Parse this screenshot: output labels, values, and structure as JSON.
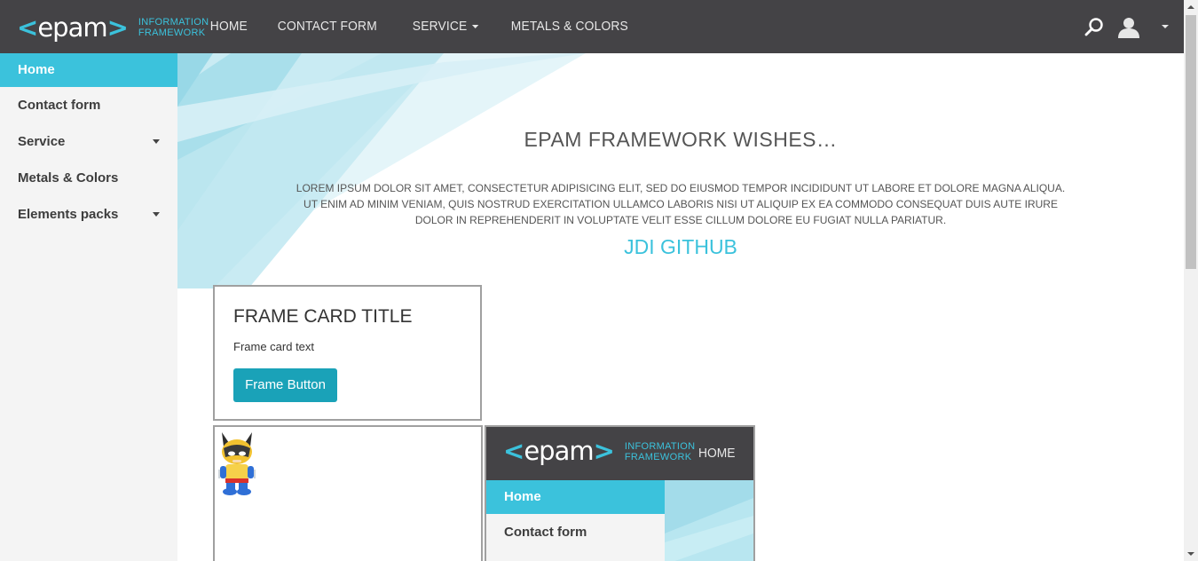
{
  "brand": {
    "logo_text": "epam",
    "logo_subtitle_line1": "INFORMATION",
    "logo_subtitle_line2": "FRAMEWORK"
  },
  "topnav": {
    "items": [
      {
        "label": "HOME"
      },
      {
        "label": "CONTACT FORM"
      },
      {
        "label": "SERVICE"
      },
      {
        "label": "METALS & COLORS"
      }
    ]
  },
  "sidebar": {
    "items": [
      {
        "label": "Home",
        "active": true
      },
      {
        "label": "Contact form"
      },
      {
        "label": "Service",
        "has_submenu": true
      },
      {
        "label": "Metals & Colors"
      },
      {
        "label": "Elements packs",
        "has_submenu": true
      }
    ]
  },
  "main": {
    "title": "EPAM FRAMEWORK WISHES…",
    "text": "LOREM IPSUM DOLOR SIT AMET, CONSECTETUR ADIPISICING ELIT, SED DO EIUSMOD TEMPOR INCIDIDUNT UT LABORE ET DOLORE MAGNA ALIQUA. UT ENIM AD MINIM VENIAM, QUIS NOSTRUD EXERCITATION ULLAMCO LABORIS NISI UT ALIQUIP EX EA COMMODO CONSEQUAT DUIS AUTE IRURE DOLOR IN REPREHENDERIT IN VOLUPTATE VELIT ESSE CILLUM DOLORE EU FUGIAT NULLA PARIATUR.",
    "github_link": "JDI GITHUB"
  },
  "frame_card": {
    "title": "FRAME CARD TITLE",
    "text": "Frame card text",
    "button_label": "Frame Button"
  },
  "mini_site": {
    "logo_text": "epam",
    "logo_subtitle_line1": "INFORMATION",
    "logo_subtitle_line2": "FRAMEWORK",
    "nav_home": "HOME",
    "sidebar_items": [
      {
        "label": "Home"
      },
      {
        "label": "Contact form"
      }
    ]
  },
  "colors": {
    "header_bg": "#444346",
    "accent": "#3bc2dc",
    "button": "#1aa2b8",
    "sidebar_bg": "#f4f4f4"
  },
  "icons": {
    "search": "search-icon",
    "user": "user-icon",
    "hero": "wolverine-icon"
  }
}
